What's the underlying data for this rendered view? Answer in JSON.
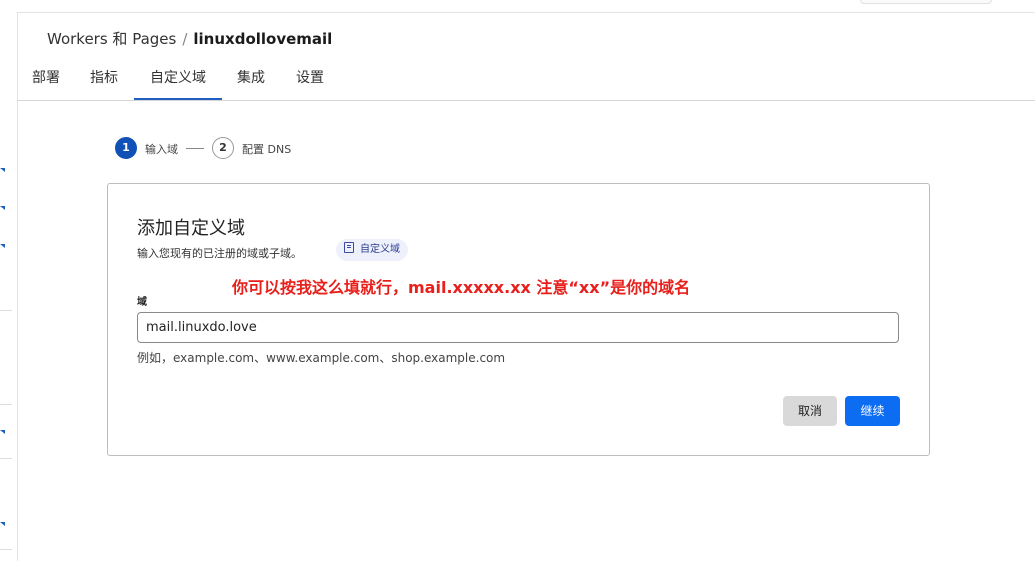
{
  "breadcrumb": {
    "parent": "Workers 和 Pages",
    "separator": "/",
    "current": "linuxdollovemail"
  },
  "tabs": [
    {
      "label": "部署"
    },
    {
      "label": "指标"
    },
    {
      "label": "自定义域"
    },
    {
      "label": "集成"
    },
    {
      "label": "设置"
    }
  ],
  "active_tab": "自定义域",
  "stepper": {
    "steps": [
      {
        "number": "1",
        "label": "输入域",
        "state": "active"
      },
      {
        "number": "2",
        "label": "配置 DNS",
        "state": "todo"
      }
    ]
  },
  "card": {
    "title": "添加自定义域",
    "subtitle": "输入您现有的已注册的域或子域。",
    "doc_chip": {
      "label": "自定义域",
      "icon": "document-icon"
    },
    "annotation": "你可以按我这么填就行，mail.xxxxx.xx 注意“xx”是你的域名",
    "field": {
      "label": "域",
      "value": "mail.linuxdo.love",
      "help": "例如，example.com、www.example.com、shop.example.com"
    },
    "buttons": {
      "cancel": "取消",
      "continue": "继续"
    }
  },
  "colors": {
    "accent": "#1f5fbf",
    "primary_button": "#0c6cf2",
    "annotation": "#e8201c",
    "chip_bg": "#eef0fb"
  }
}
